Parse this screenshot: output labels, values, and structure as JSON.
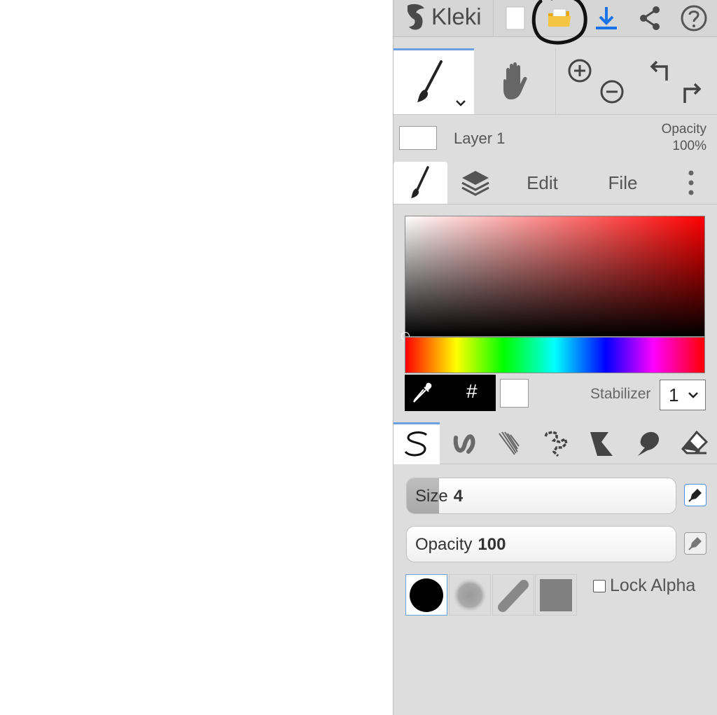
{
  "app": {
    "name": "Kleki"
  },
  "toolbar": {
    "icons": [
      "new-image-icon",
      "open-folder-icon",
      "download-icon",
      "share-icon",
      "help-icon"
    ]
  },
  "tools": {
    "items": [
      "brush-tool-icon",
      "hand-tool-icon",
      "zoom-in-icon",
      "zoom-out-icon",
      "undo-icon",
      "redo-icon"
    ]
  },
  "layer": {
    "name": "Layer 1",
    "opacity_label": "Opacity",
    "opacity_value": "100%"
  },
  "tabs": {
    "edit": "Edit",
    "file": "File"
  },
  "color": {
    "hash": "#",
    "current": "#ffffff",
    "stabilizer_label": "Stabilizer",
    "stabilizer_value": "1"
  },
  "brush_tabs": [
    "pen-brush-icon",
    "blend-brush-icon",
    "sketchy-brush-icon",
    "pixel-brush-icon",
    "chemy-brush-icon",
    "smudge-brush-icon",
    "eraser-icon"
  ],
  "brush": {
    "size_label": "Size",
    "size_value": "4",
    "size_fraction": 0.12,
    "opacity_label": "Opacity",
    "opacity_value": "100",
    "opacity_fraction": 1.0,
    "lock_alpha_label": "Lock Alpha",
    "lock_alpha_checked": false
  },
  "colors": {
    "accent": "#6a9fe0",
    "download_blue": "#1a73e8",
    "folder_yellow": "#f2b600"
  }
}
